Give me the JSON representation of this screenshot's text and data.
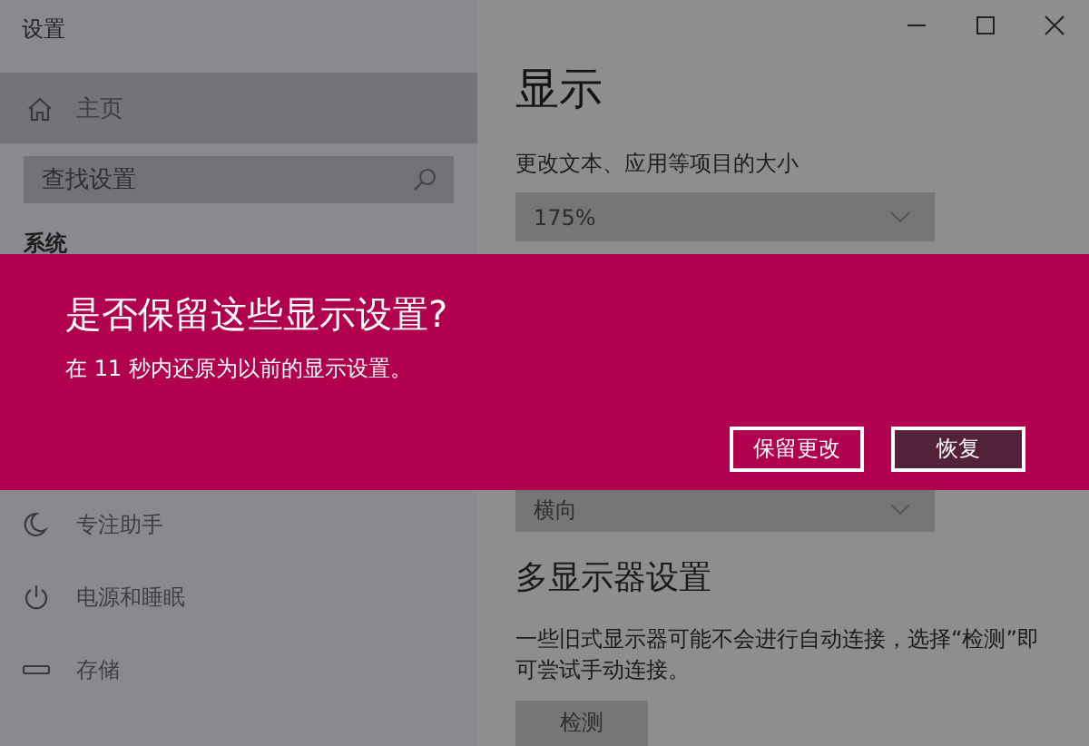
{
  "window": {
    "title": "设置"
  },
  "sidebar": {
    "home": {
      "label": "主页",
      "selected": true
    },
    "search": {
      "placeholder": "查找设置"
    },
    "section": "系统",
    "items": [
      {
        "label": "专注助手",
        "kind": "moon",
        "selected": false
      },
      {
        "label": "电源和睡眠",
        "kind": "power",
        "selected": false
      },
      {
        "label": "存储",
        "kind": "storage",
        "selected": false
      }
    ]
  },
  "content": {
    "heading": "显示",
    "scale_label": "更改文本、应用等项目的大小",
    "scale_value": "175%",
    "orientation_value": "横向",
    "multi_heading": "多显示器设置",
    "multi_text": "一些旧式显示器可能不会进行自动连接，选择“检测”即可尝试手动连接。",
    "detect_button": "检测"
  },
  "dialog": {
    "title": "是否保留这些显示设置?",
    "message": "在 11 秒内还原为以前的显示设置。",
    "buttons": [
      {
        "label": "保留更改",
        "default": false
      },
      {
        "label": "恢复",
        "default": true
      }
    ]
  }
}
